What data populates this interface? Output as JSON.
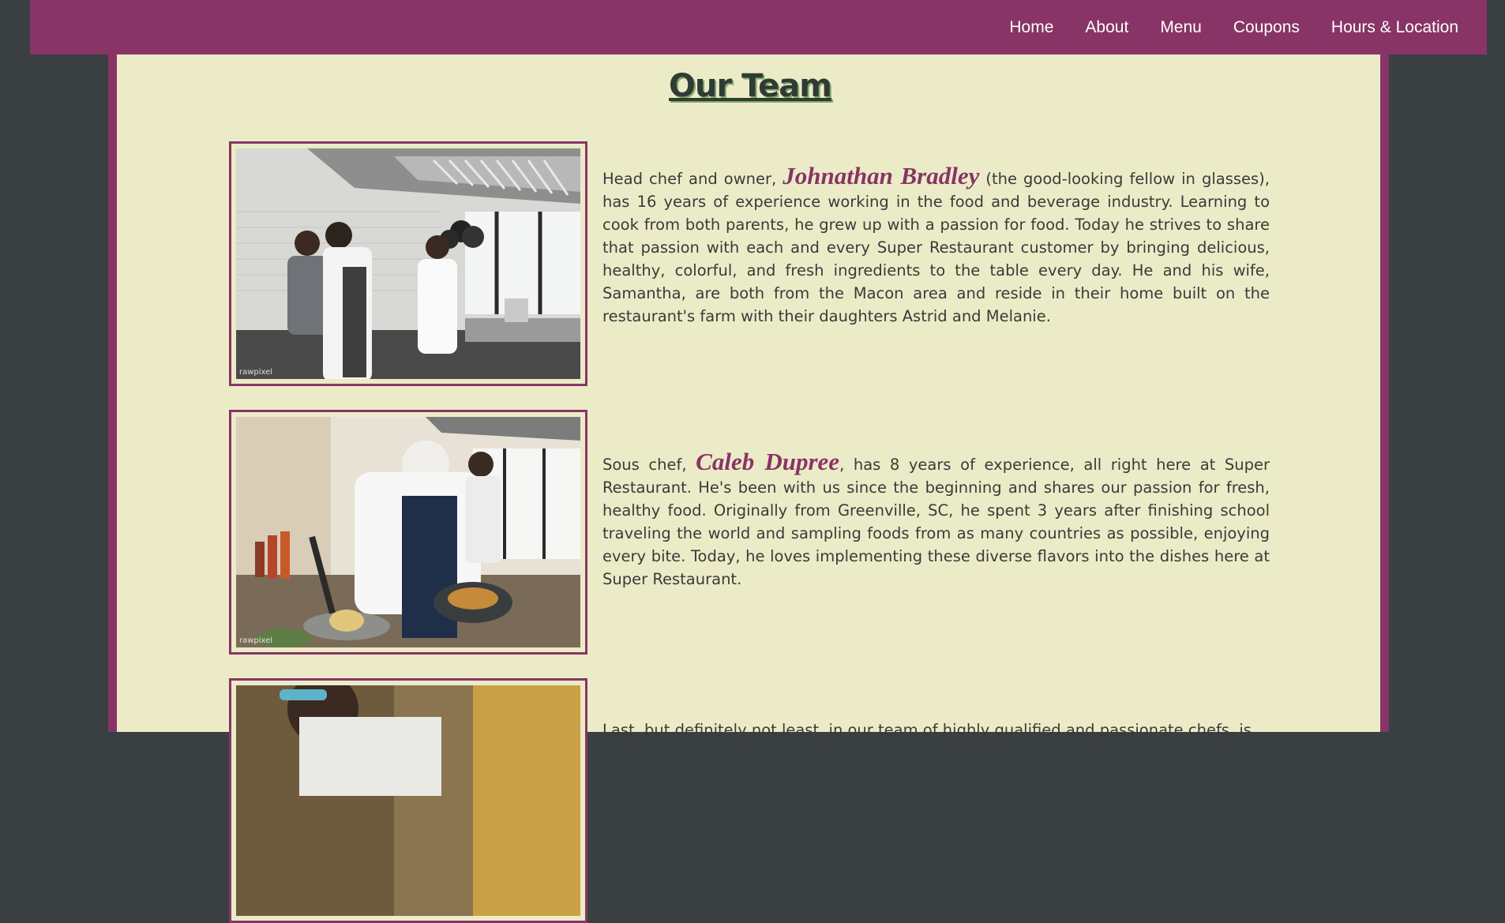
{
  "nav": {
    "items": [
      "Home",
      "About",
      "Menu",
      "Coupons",
      "Hours & Location"
    ]
  },
  "page": {
    "title": "Our Team"
  },
  "team": [
    {
      "before": "Head chef and owner, ",
      "name": "Johnathan Bradley",
      "after": " (the good-looking fellow in glasses), has 16 years of experience working in the food and beverage industry. Learning to cook from both parents, he grew up with a passion for food. Today he strives to share that passion with each and every Super Restaurant customer by bringing delicious, healthy, colorful, and fresh ingredients to the table every day. He and his wife, Samantha, are both from the Macon area and reside in their home built on the restaurant's farm with their daughters Astrid and Melanie.",
      "watermark": "rawpixel"
    },
    {
      "before": "Sous chef, ",
      "name": "Caleb Dupree",
      "after": ", has 8 years of experience, all right here at Super Restaurant. He's been with us since the beginning and shares our passion for fresh, healthy food. Originally from Greenville, SC, he spent 3 years after finishing school traveling the world and sampling foods from as many countries as possible, enjoying every bite. Today, he loves implementing these diverse flavors into the dishes here at Super Restaurant.",
      "watermark": "rawpixel"
    },
    {
      "before": "Last, but definitely not least, in our team of highly qualified and passionate chefs, is"
    }
  ],
  "colors": {
    "brand": "#883466",
    "panel": "#ecebc7",
    "background": "#3a3f42",
    "title_shadow": "#7fa86a"
  }
}
